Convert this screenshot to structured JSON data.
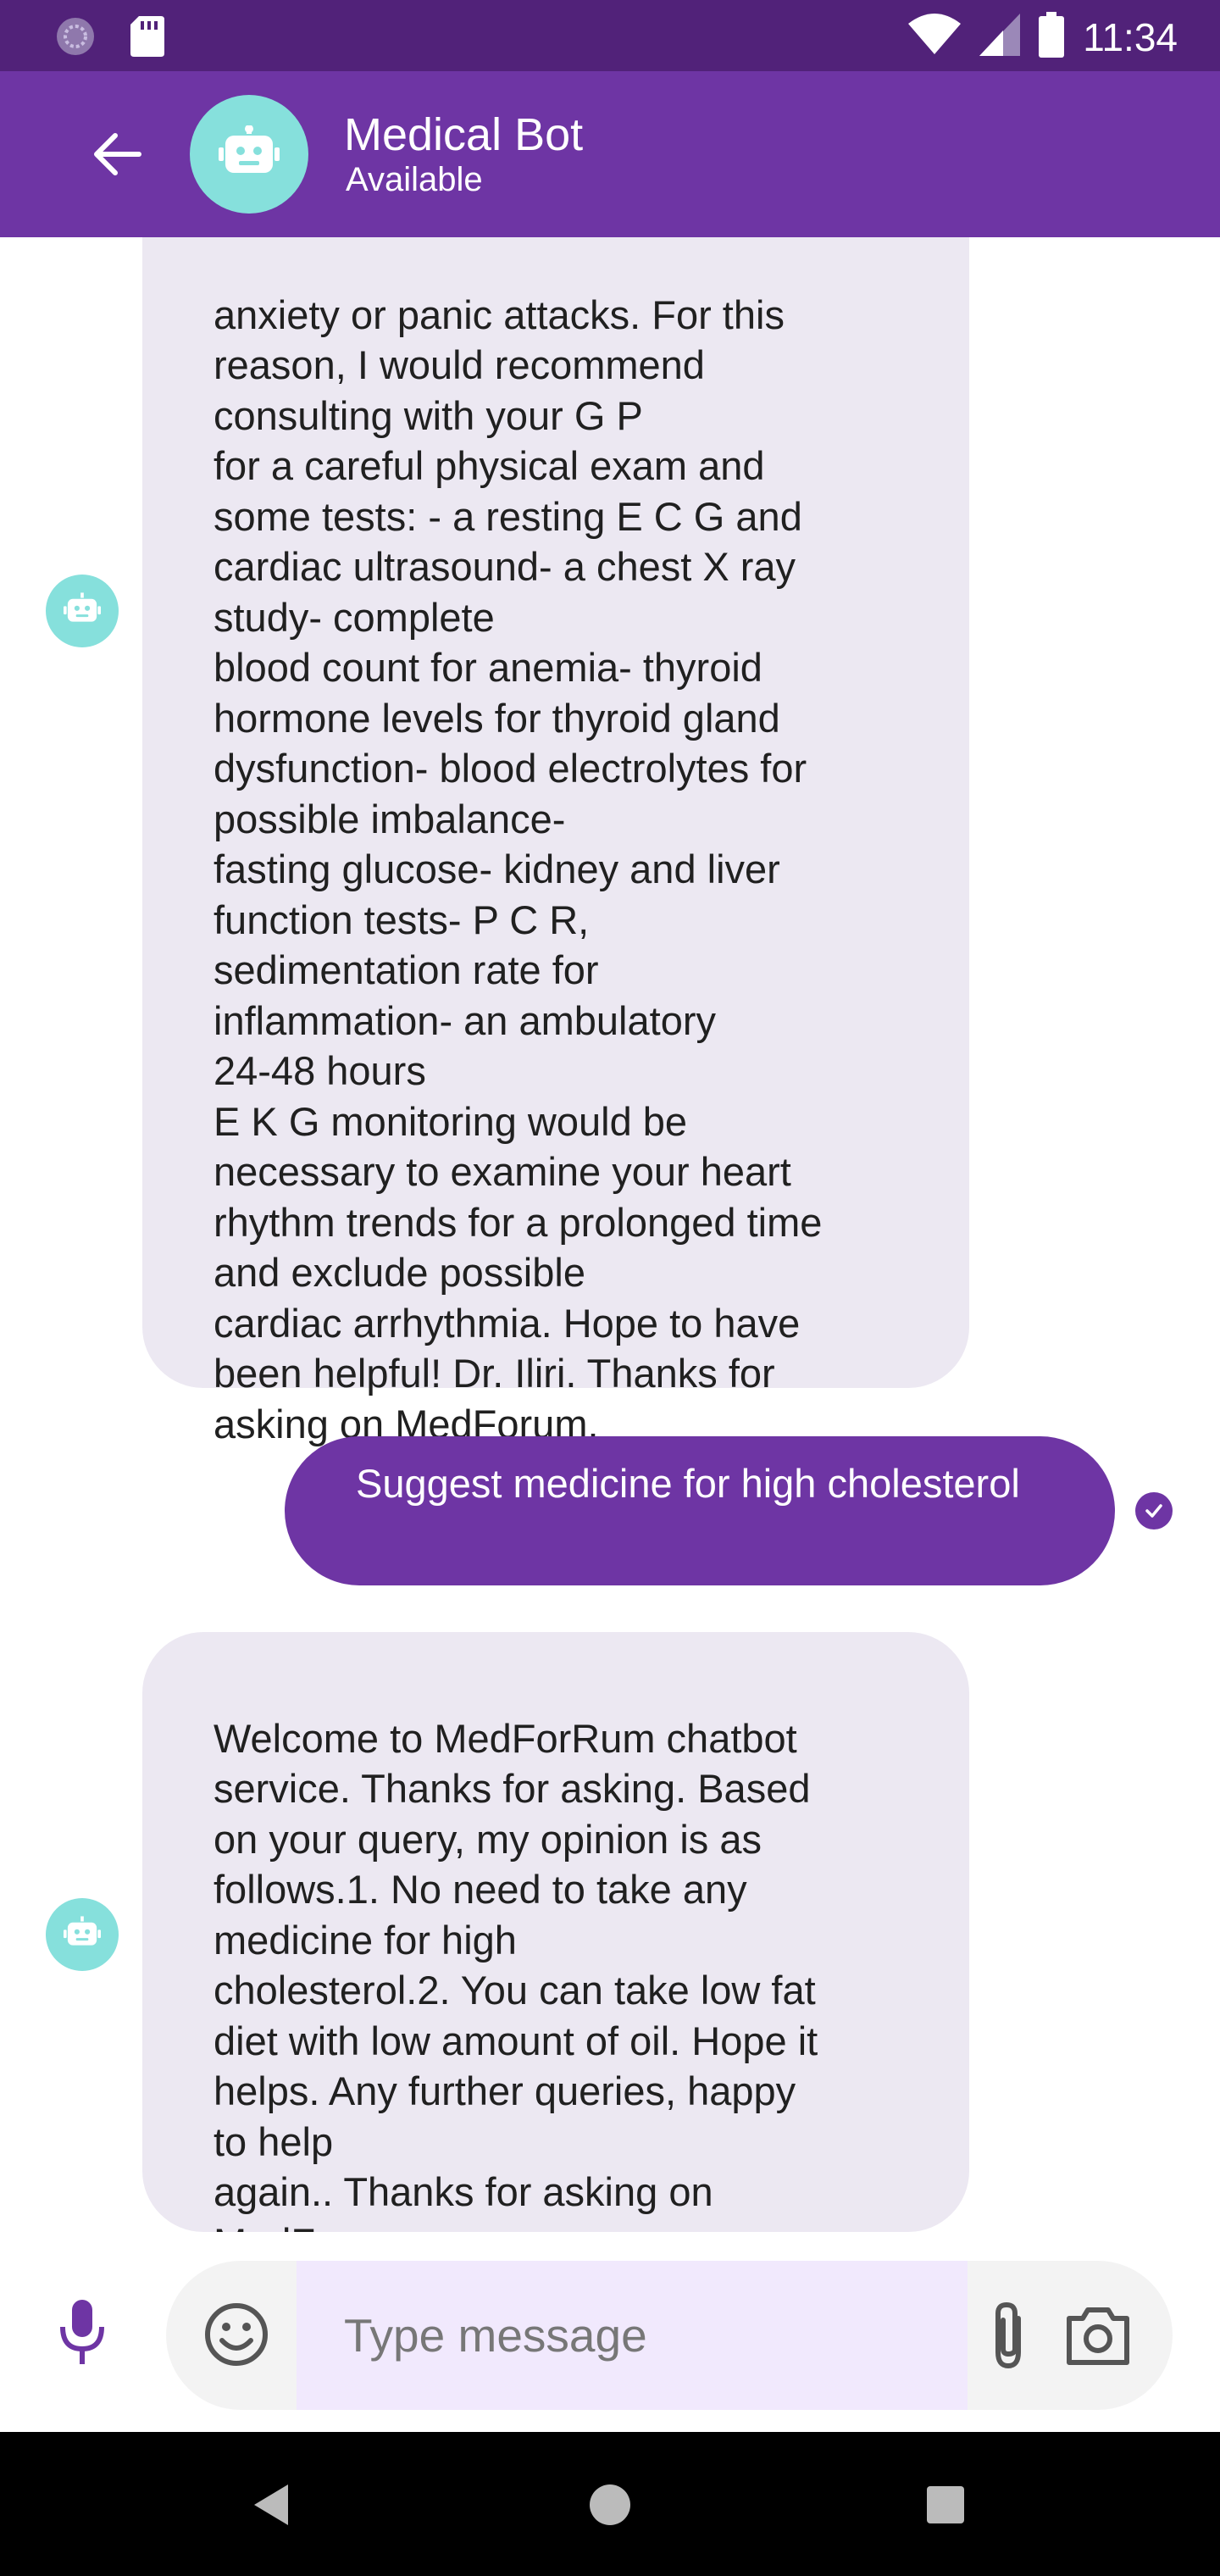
{
  "status_bar": {
    "time": "11:34",
    "icons": [
      "pinwheel-icon",
      "sd-card-icon",
      "wifi-icon",
      "signal-icon",
      "battery-icon"
    ]
  },
  "header": {
    "title": "Medical Bot",
    "subtitle": "Available",
    "icons": [
      "back-arrow-icon",
      "robot-icon"
    ]
  },
  "messages": [
    {
      "sender": "bot",
      "text": "anxiety or panic attacks.  For this\nreason,  I would recommend\nconsulting with your  G P\nfor a careful physical exam and\nsome tests: - a resting  E C G and\ncardiac ultrasound- a chest  X ray\nstudy- complete\nblood count for anemia- thyroid\nhormone levels for thyroid gland\ndysfunction- blood electrolytes for\npossible imbalance-\nfasting glucose- kidney and liver\nfunction tests-  P C R,\nsedimentation rate for\ninflammation- an ambulatory\n24-48 hours\nE K G monitoring would be\nnecessary to examine your heart\nrhythm trends for a prolonged time\nand exclude possible\ncardiac arrhythmia. Hope to have\nbeen helpful! Dr. Iliri. Thanks for\nasking on MedForum."
    },
    {
      "sender": "user",
      "text": "Suggest medicine for high cholesterol",
      "status": "sent-check-icon"
    },
    {
      "sender": "bot",
      "text": "Welcome to MedForRum chatbot\nservice. Thanks for asking. Based\non your query, my opinion is as\nfollows.1.  No need to take any\nmedicine for high\ncholesterol.2. You can take low fat\ndiet with low amount of oil. Hope it\nhelps. Any further queries, happy\nto help\nagain.. Thanks for asking on\nMedForum."
    }
  ],
  "input_bar": {
    "placeholder": "Type message",
    "value": "",
    "icons": [
      "microphone-icon",
      "emoji-icon",
      "attachment-icon",
      "camera-icon"
    ]
  },
  "nav_bar": {
    "icons": [
      "back-triangle-icon",
      "home-circle-icon",
      "recents-square-icon"
    ]
  },
  "colors": {
    "status_bar": "#512279",
    "app_bar": "#6e35a4",
    "avatar": "#86e0dc",
    "bot_bubble": "#ece8f2",
    "user_bubble": "#6e35a4",
    "input_field": "#f1e9fd"
  }
}
